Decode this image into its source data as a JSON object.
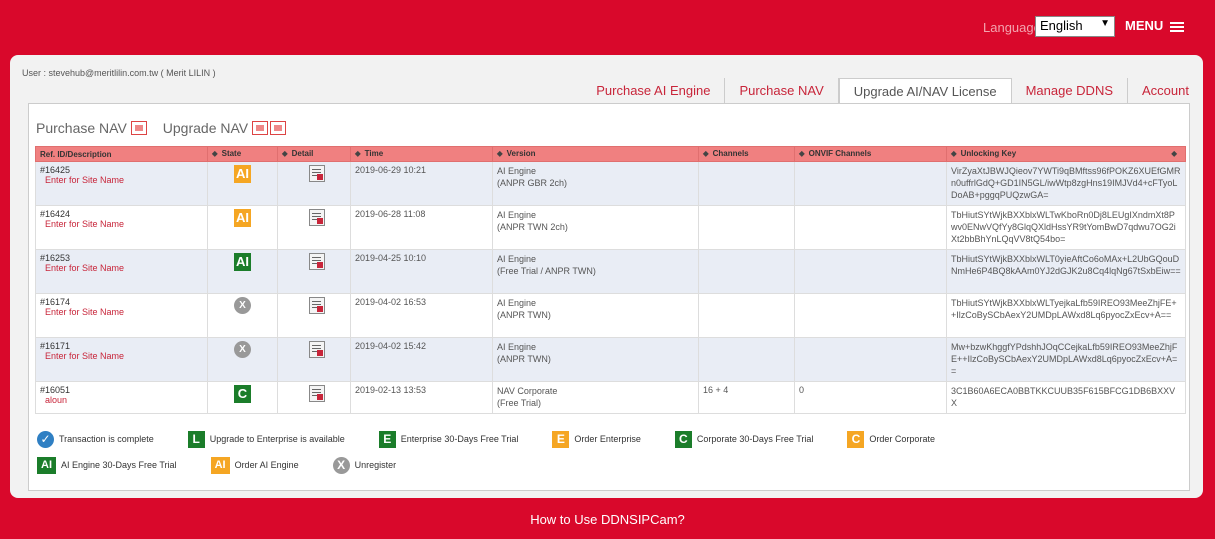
{
  "header": {
    "language_label": "Language:",
    "language_value": "English",
    "menu_label": "MENU"
  },
  "user_line": "User : stevehub@meritlilin.com.tw ( Merit LILIN )",
  "tabs": [
    {
      "label": "Purchase AI Engine"
    },
    {
      "label": "Purchase NAV"
    },
    {
      "label": "Upgrade AI/NAV License"
    },
    {
      "label": "Manage DDNS"
    },
    {
      "label": "Account"
    }
  ],
  "subhead": {
    "purchase_nav": "Purchase NAV",
    "upgrade_nav": "Upgrade NAV"
  },
  "table": {
    "headers": [
      "Ref. ID/Description",
      "State",
      "Detail",
      "Time",
      "Version",
      "Channels",
      "ONVIF Channels",
      "Unlocking Key"
    ],
    "rows": [
      {
        "ref": "#16425",
        "desc": "Enter for Site Name",
        "state": "AI",
        "time": "2019-06-29 10:21",
        "ver1": "AI Engine",
        "ver2": "(ANPR GBR 2ch)",
        "ch": "",
        "onvif": "",
        "key": "VirZyaXtJBWJQieov7YWTi9qBMftss96fPOKZ6XUEfGMRn0uffrlGdQ+GD1IN5GL/iwWtp8zgHns19IMJVd4+cFTyoLDoAB+pggqPUQzwGA="
      },
      {
        "ref": "#16424",
        "desc": "Enter for Site Name",
        "state": "AI",
        "time": "2019-06-28 11:08",
        "ver1": "AI Engine",
        "ver2": "(ANPR TWN 2ch)",
        "ch": "",
        "onvif": "",
        "key": "TbHiutSYtWjkBXXblxWLTwKboRn0Dj8LEUgIXndmXt8Pwv0ENwVQfYy8GlqQXldHssYR9tYomBwD7qdwu7OG2iXt2bbBhYnLQqVV8tQ54bo="
      },
      {
        "ref": "#16253",
        "desc": "Enter for Site Name",
        "state": "AI",
        "time": "2019-04-25 10:10",
        "ver1": "AI Engine",
        "ver2": "(Free Trial / ANPR TWN)",
        "ch": "",
        "onvif": "",
        "key": "TbHiutSYtWjkBXXblxWLT0yieAftCo6oMAx+L2UbGQouDNmHe6P4BQ8kAAm0YJ2dGJK2u8Cq4lqNg67tSxbEiw=="
      },
      {
        "ref": "#16174",
        "desc": "Enter for Site Name",
        "state": "X",
        "time": "2019-04-02 16:53",
        "ver1": "AI Engine",
        "ver2": "(ANPR TWN)",
        "ch": "",
        "onvif": "",
        "key": "TbHiutSYtWjkBXXblxWLTyejkaLfb59IREO93MeeZhjFE++IlzCoBySCbAexY2UMDpLAWxd8Lq6pyocZxEcv+A=="
      },
      {
        "ref": "#16171",
        "desc": "Enter for Site Name",
        "state": "X",
        "time": "2019-04-02 15:42",
        "ver1": "AI Engine",
        "ver2": "(ANPR TWN)",
        "ch": "",
        "onvif": "",
        "key": "Mw+bzwKhggfYPdshhJOqCCejkaLfb59IREO93MeeZhjFE++IlzCoBySCbAexY2UMDpLAWxd8Lq6pyocZxEcv+A=="
      },
      {
        "ref": "#16051",
        "desc": "aloun",
        "state": "C",
        "time": "2019-02-13 13:53",
        "ver1": "NAV Corporate",
        "ver2": "(Free Trial)",
        "ch": "16 + 4",
        "onvif": "0",
        "key": "3C1B60A6ECA0BBTKKCUUB35F615BFCG1DB6BXXVX"
      }
    ]
  },
  "legend": [
    {
      "badge": "✓",
      "text": "Transaction is complete",
      "color": "#2f7fc3"
    },
    {
      "badge": "L",
      "text": "Upgrade to Enterprise is available",
      "color": "#1b7d2a"
    },
    {
      "badge": "E",
      "text": "Enterprise 30-Days Free Trial",
      "color": "#1b7d2a"
    },
    {
      "badge": "E",
      "text": "Order Enterprise",
      "color": "#f5a623"
    },
    {
      "badge": "C",
      "text": "Corporate 30-Days Free Trial",
      "color": "#1b7d2a"
    },
    {
      "badge": "C",
      "text": "Order Corporate",
      "color": "#f5a623"
    },
    {
      "badge": "AI",
      "text": "AI Engine 30-Days Free Trial",
      "color": "#1b7d2a"
    },
    {
      "badge": "AI",
      "text": "Order AI Engine",
      "color": "#f5a623"
    },
    {
      "badge": "X",
      "text": "Unregister",
      "color": "#999999"
    }
  ],
  "footer": {
    "link": "How to Use DDNSIPCam?"
  }
}
